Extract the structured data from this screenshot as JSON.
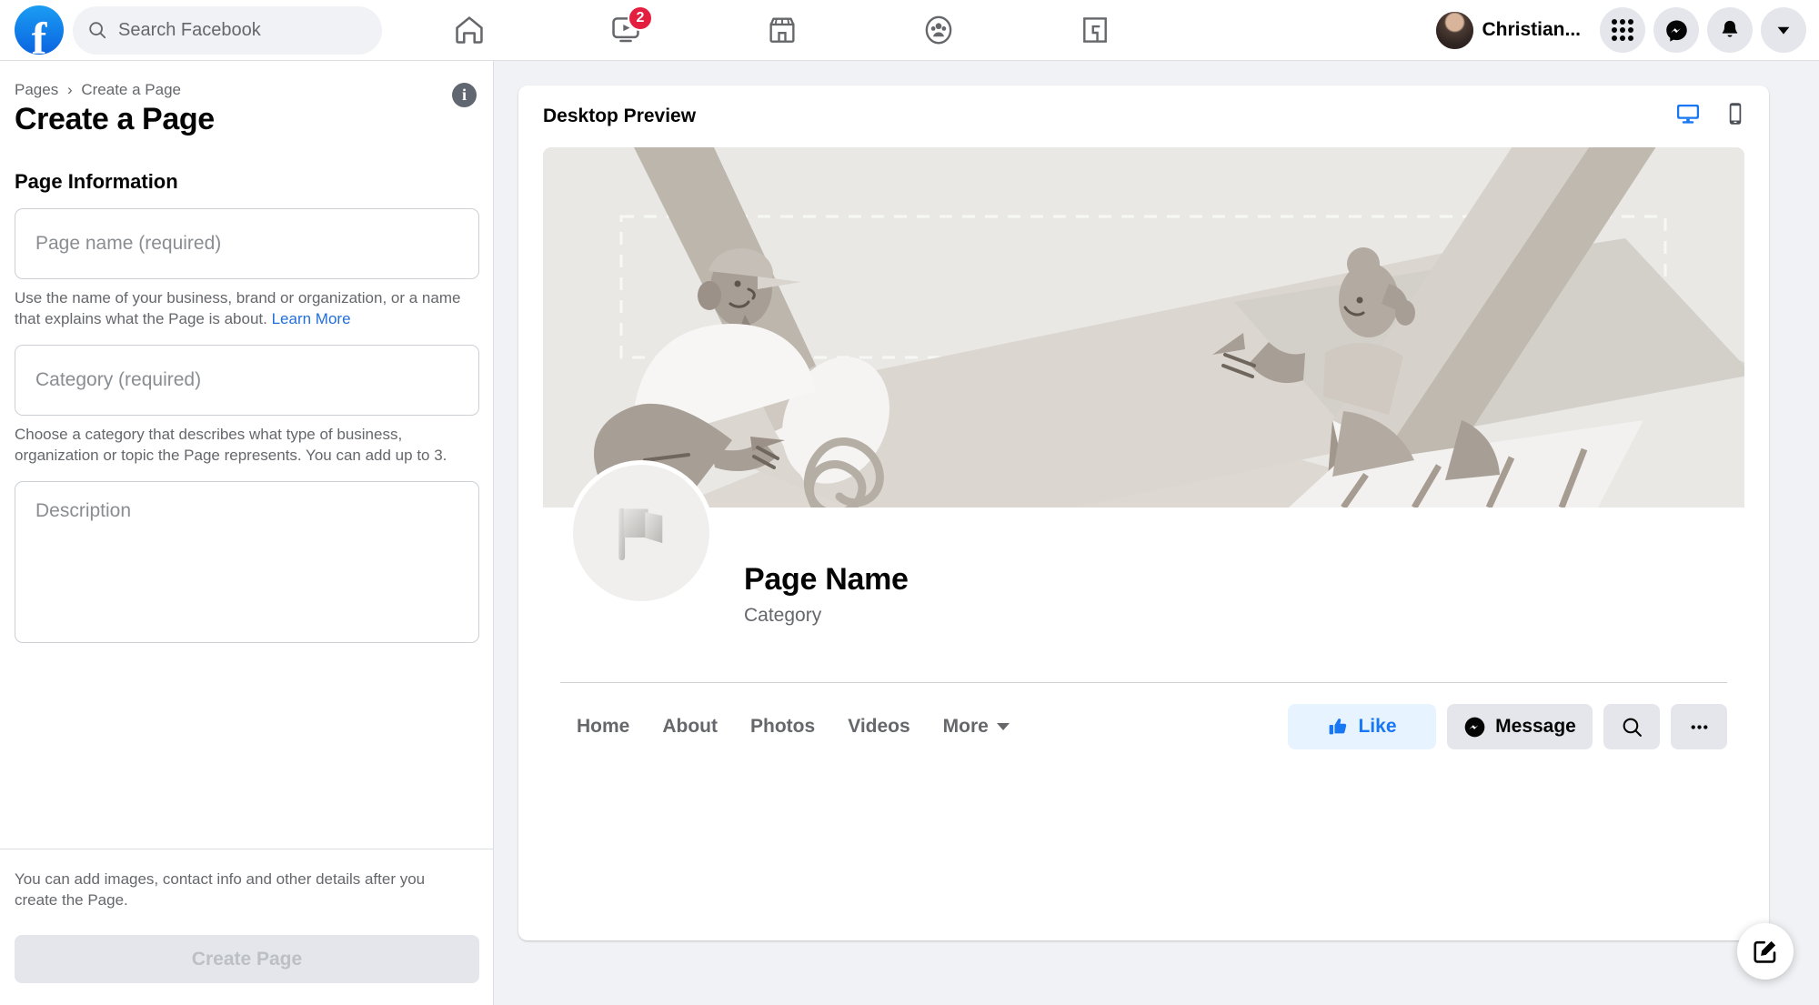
{
  "topnav": {
    "logo_alt": "facebook-logo",
    "search": {
      "placeholder": "Search Facebook"
    },
    "tabs": [
      {
        "name": "home",
        "icon": "home-icon",
        "badge": ""
      },
      {
        "name": "video",
        "icon": "video-icon",
        "badge": "2"
      },
      {
        "name": "marketplace",
        "icon": "marketplace-icon",
        "badge": ""
      },
      {
        "name": "groups",
        "icon": "groups-icon",
        "badge": ""
      },
      {
        "name": "gaming",
        "icon": "gaming-icon",
        "badge": ""
      }
    ],
    "profile_name": "Christian...",
    "right_buttons": [
      "menu-grid-icon",
      "messenger-icon",
      "notifications-icon",
      "account-chevron-icon"
    ]
  },
  "sidebar": {
    "breadcrumb": {
      "root": "Pages",
      "separator": "›",
      "current": "Create a Page"
    },
    "title": "Create a Page",
    "info_icon_label": "i",
    "section_title": "Page Information",
    "fields": [
      {
        "name": "page-name",
        "placeholder": "Page name (required)",
        "value": "",
        "helper": "Use the name of your business, brand or organization, or a name that explains what the Page is about.",
        "helper_link": "Learn More"
      },
      {
        "name": "category",
        "placeholder": "Category (required)",
        "value": "",
        "helper": "Choose a category that describes what type of business, organization or topic the Page represents. You can add up to 3.",
        "helper_link": ""
      },
      {
        "name": "description",
        "placeholder": "Description",
        "value": "",
        "helper": "",
        "helper_link": ""
      }
    ],
    "footer_note": "You can add images, contact info and other details after you create the Page.",
    "create_button": "Create Page"
  },
  "preview": {
    "title": "Desktop Preview",
    "devices": [
      {
        "name": "desktop",
        "icon": "desktop-icon",
        "active": true,
        "color": "#1877f2"
      },
      {
        "name": "mobile",
        "icon": "mobile-icon",
        "active": false,
        "color": "#4b4f56"
      }
    ],
    "cover_alt": "page-cover-illustration",
    "page_avatar_alt": "flag-placeholder-icon",
    "page_name": "Page Name",
    "page_category": "Category",
    "tabs": [
      "Home",
      "About",
      "Photos",
      "Videos",
      "More"
    ],
    "actions": {
      "like": "Like",
      "message": "Message",
      "search_icon": "search-icon",
      "more_icon": "ellipsis-icon"
    },
    "fab_icon": "compose-icon"
  },
  "colors": {
    "facebook_blue": "#1877f2",
    "badge_red": "#e41e3f",
    "page_bg": "#f0f2f5",
    "text_primary": "#050505",
    "text_secondary": "#65676b",
    "like_bg": "#e7f3ff"
  }
}
